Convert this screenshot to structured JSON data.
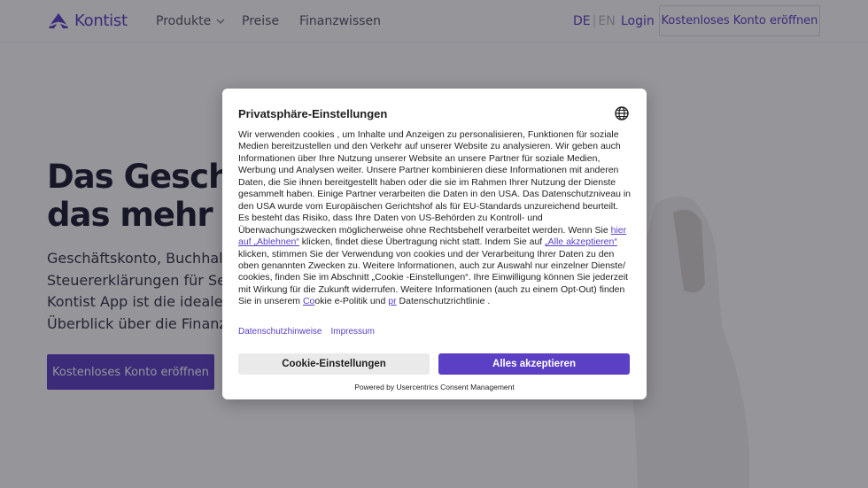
{
  "navbar": {
    "logo_text": "Kontist",
    "items": [
      "Produkte",
      "Preise",
      "Finanzwissen"
    ],
    "lang_de": "DE",
    "lang_sep": "|",
    "lang_en": "EN",
    "login": "Login",
    "cta": "Kostenloses Konto eröffnen"
  },
  "hero": {
    "title": "Das Geschä\ndas mehr zu",
    "text": "Geschäftskonto, Buchhaltu\nSteuererklärungen für Selb\nKontist App ist die ideale A\nÜberblick über die Finanze",
    "cta": "Kostenloses Konto eröffnen"
  },
  "consent": {
    "title": "Privatsphäre-Einstellungen",
    "body_1": "Wir verwenden cookies , um Inhalte und Anzeigen zu personalisieren, Funktionen für soziale Medien bereitzustellen und den Verkehr auf unserer Website zu analysieren. Wir geben auch Informationen über Ihre Nutzung unserer Website an unsere Partner für soziale Medien, Werbung und Analysen weiter. Unsere Partner kombinieren diese Informationen mit anderen Daten, die Sie ihnen bereitgestellt haben oder die sie im Rahmen Ihrer Nutzung der Dienste gesammelt haben. Einige Partner verarbeiten die Daten in den USA. Das Datenschutzniveau in den USA wurde vom Europäischen Gerichtshof als für EU-Standards unzureichend beurteilt. Es besteht das Risiko, dass Ihre Daten von US-Behörden zu Kontroll- und Überwachungszwecken möglicherweise ohne Rechtsbehelf verarbeitet werden. Wenn Sie ",
    "link_reject": "hier auf „Ablehnen“",
    "body_2": " klicken, findet diese Übertragung nicht statt. Indem Sie auf ",
    "link_accept_all": "„Alle akzeptieren“",
    "body_3": " klicken, stimmen Sie der Verwendung von cookies und der Verarbeitung Ihrer Daten zu den oben genannten Zwecken zu. Weitere Informationen, auch zur Auswahl nur einzelner Dienste/ cookies, finden Sie im Abschnitt „Cookie -Einstellungen“. Ihre Einwilligung können Sie jederzeit mit Wirkung für die Zukunft widerrufen. Weitere Informationen (auch zu einem Opt-Out) finden Sie in unserem ",
    "link_cookie_1": "Co",
    "body_4": "okie e-Politik und ",
    "link_privacy_1": "pr",
    "body_5": " Datenschutzrichtlinie .",
    "link_datenschutz": "Datenschutzhinweise",
    "link_impressum": "Impressum",
    "btn_settings": "Cookie-Einstellungen",
    "btn_accept": "Alles akzeptieren",
    "powered_by": "Powered by Usercentrics Consent Management"
  },
  "colors": {
    "brand": "#5b3fc4",
    "overlay": "rgba(20,20,30,0.45)",
    "settings_button": "#eaeaea"
  },
  "icons": [
    "kontist-logo-icon",
    "chevron-down-icon",
    "globe-icon"
  ]
}
